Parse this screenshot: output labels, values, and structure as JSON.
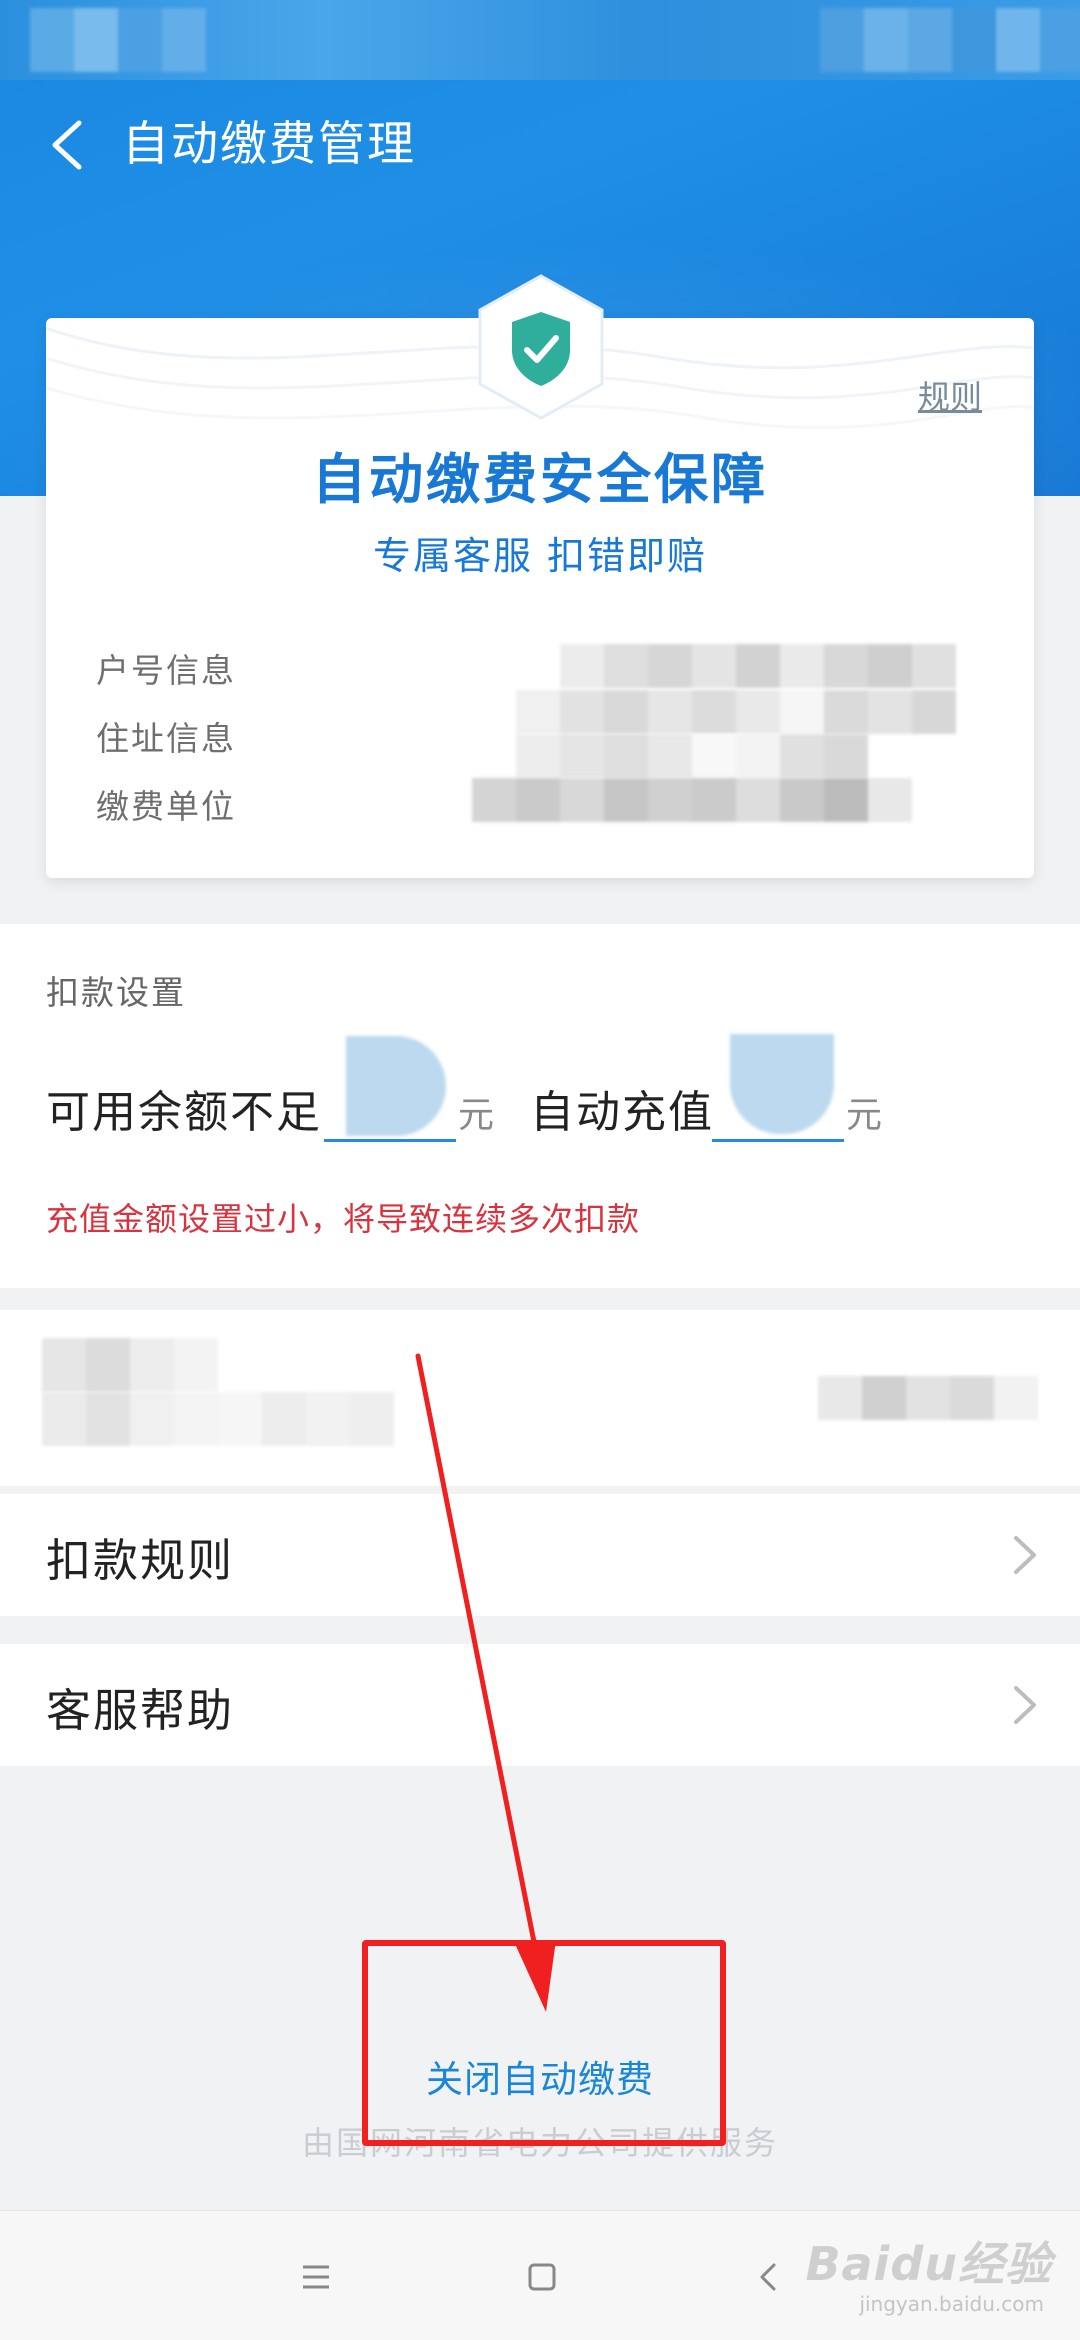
{
  "header": {
    "title": "自动缴费管理",
    "back_icon": "chevron-left-icon"
  },
  "card": {
    "rules_link": "规则",
    "title": "自动缴费安全保障",
    "subtitle": "专属客服 扣错即赔",
    "badge_icon": "shield-check-icon",
    "info_labels": [
      "户号信息",
      "住址信息",
      "缴费单位"
    ]
  },
  "settings": {
    "section_label": "扣款设置",
    "balance_label": "可用余额不足",
    "unit": "元",
    "recharge_label": "自动充值",
    "warning": "充值金额设置过小，将导致连续多次扣款"
  },
  "menu": {
    "deduction_rules": "扣款规则",
    "customer_help": "客服帮助"
  },
  "actions": {
    "close_auto_pay": "关闭自动缴费"
  },
  "footer": {
    "provider_note": "由国网河南省电力公司提供服务"
  },
  "watermark": {
    "brand": "Baidu经验",
    "url": "jingyan.baidu.com"
  },
  "colors": {
    "header_blue": "#1a87e0",
    "accent": "#1878d6",
    "warning": "#d8333e",
    "annotation_red": "#f02020"
  }
}
